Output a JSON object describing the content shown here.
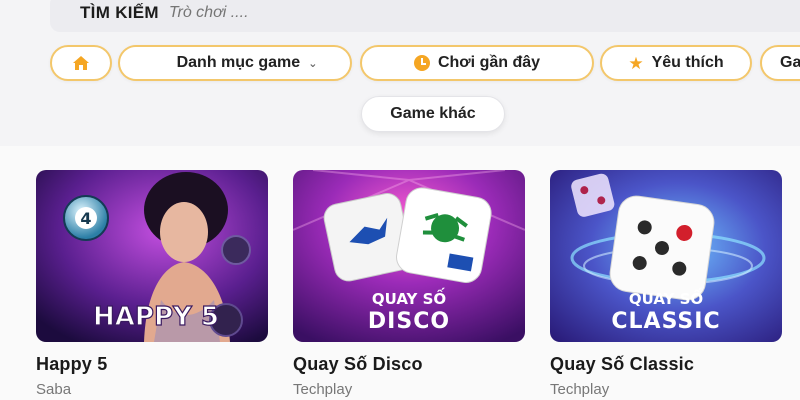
{
  "search": {
    "label": "TÌM KIẾM",
    "placeholder": "Trò chơi ...."
  },
  "categories": {
    "home_label": "",
    "items": [
      {
        "label": "Danh mục game",
        "icon": "grid-icon"
      },
      {
        "label": "Chơi gần đây",
        "icon": "clock-icon"
      },
      {
        "label": "Yêu thích",
        "icon": "star-icon"
      },
      {
        "label": "Ga"
      },
      {
        "label": "Game khác"
      }
    ]
  },
  "games": [
    {
      "title": "Happy 5",
      "provider": "Saba",
      "art_text": "HAPPY 5",
      "ball": "4"
    },
    {
      "title": "Quay Số Disco",
      "provider": "Techplay",
      "art_top": "QUAY SỐ",
      "art_bottom": "DISCO"
    },
    {
      "title": "Quay Số Classic",
      "provider": "Techplay",
      "art_top": "QUAY SỐ",
      "art_bottom": "CLASSIC"
    }
  ],
  "colors": {
    "accent": "#f5a623",
    "pill_border": "#f3c76b"
  }
}
